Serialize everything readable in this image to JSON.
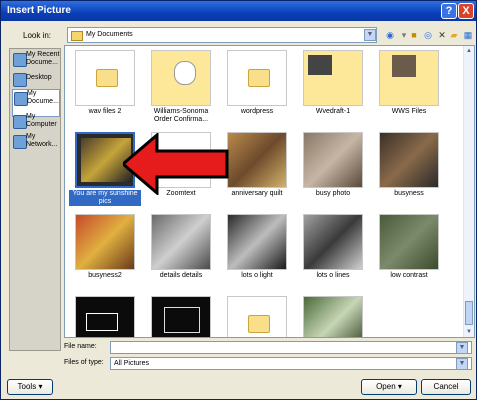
{
  "window": {
    "title": "Insert Picture"
  },
  "titlebar": {
    "help": "?",
    "close": "X"
  },
  "lookin": {
    "label": "Look in:",
    "value": "My Documents"
  },
  "places": [
    {
      "label": "My Recent Docume..."
    },
    {
      "label": "Desktop"
    },
    {
      "label": "My Docume...",
      "selected": true
    },
    {
      "label": "My Computer"
    },
    {
      "label": "My Network..."
    }
  ],
  "files": [
    {
      "label": "wav files 2",
      "type": "folder"
    },
    {
      "label": "Williams-Sonoma Order Confirma...",
      "type": "folder-doc"
    },
    {
      "label": "wordpress",
      "type": "folder"
    },
    {
      "label": "Wvedraft-1",
      "type": "folder-doc2"
    },
    {
      "label": "WWS Files",
      "type": "folder-photo"
    },
    {
      "label": "You are my sunshine pics",
      "type": "photo",
      "selected": true
    },
    {
      "label": "Zoomtext",
      "type": "folder"
    },
    {
      "label": "anniversary quilt",
      "type": "photo"
    },
    {
      "label": "busy photo",
      "type": "photo"
    },
    {
      "label": "busyness",
      "type": "photo"
    },
    {
      "label": "busyness2",
      "type": "photo"
    },
    {
      "label": "details details",
      "type": "photo"
    },
    {
      "label": "lots o light",
      "type": "photo"
    },
    {
      "label": "lots o lines",
      "type": "photo"
    },
    {
      "label": "low contrast",
      "type": "photo"
    },
    {
      "label": "",
      "type": "photo-dark"
    },
    {
      "label": "",
      "type": "photo-dark"
    },
    {
      "label": "",
      "type": "folder"
    },
    {
      "label": "",
      "type": "photo"
    }
  ],
  "filename": {
    "label": "File name:",
    "value": ""
  },
  "filetype": {
    "label": "Files of type:",
    "value": "All Pictures"
  },
  "buttons": {
    "tools": "Tools",
    "open": "Open",
    "cancel": "Cancel"
  }
}
